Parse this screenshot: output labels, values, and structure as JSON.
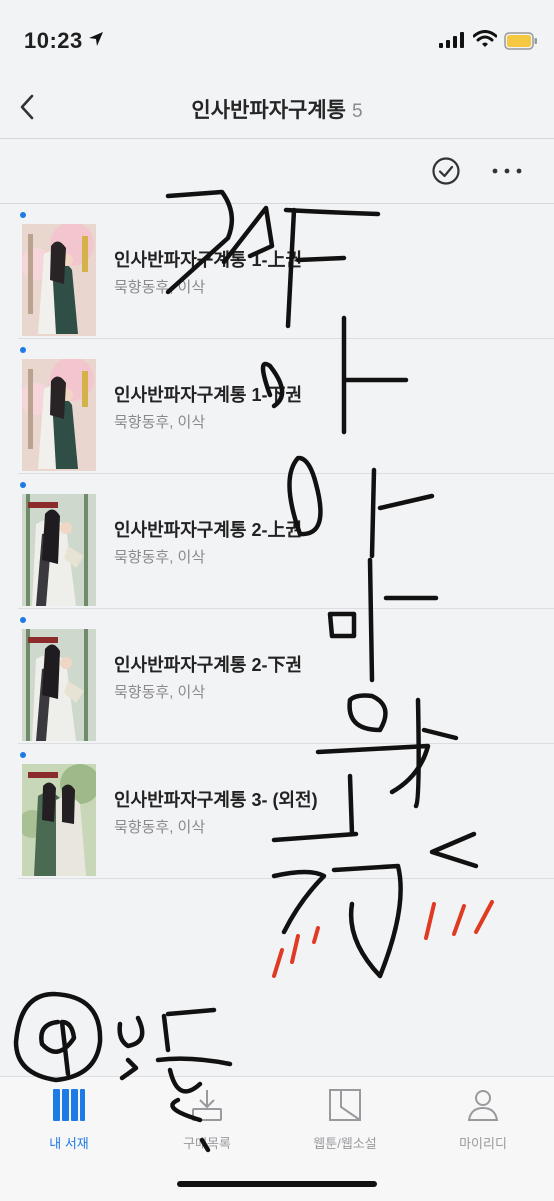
{
  "status_bar": {
    "time": "10:23"
  },
  "header": {
    "title": "인사반파자구계통",
    "count": "5"
  },
  "books": [
    {
      "title": "인사반파자구계통 1-上권",
      "author": "묵향동후, 이삭",
      "cover": "pink"
    },
    {
      "title": "인사반파자구계통 1-下권",
      "author": "묵향동후, 이삭",
      "cover": "pink"
    },
    {
      "title": "인사반파자구계통 2-上권",
      "author": "묵향동후, 이삭",
      "cover": "bamboo"
    },
    {
      "title": "인사반파자구계통 2-下권",
      "author": "묵향동후, 이삭",
      "cover": "bamboo"
    },
    {
      "title": "인사반파자구계통 3- (외전)",
      "author": "묵향동후, 이삭",
      "cover": "green"
    }
  ],
  "tabs": [
    {
      "label": "내 서재",
      "icon": "library-icon",
      "active": true
    },
    {
      "label": "구매목록",
      "icon": "purchase-list-icon",
      "active": false
    },
    {
      "label": "웹툰/웹소설",
      "icon": "webtoon-icon",
      "active": false
    },
    {
      "label": "마이리디",
      "icon": "profile-icon",
      "active": false
    }
  ],
  "colors": {
    "accent": "#1e7be6",
    "ink": "#111111",
    "ink_red": "#e03a22",
    "battery": "#f5c842"
  }
}
